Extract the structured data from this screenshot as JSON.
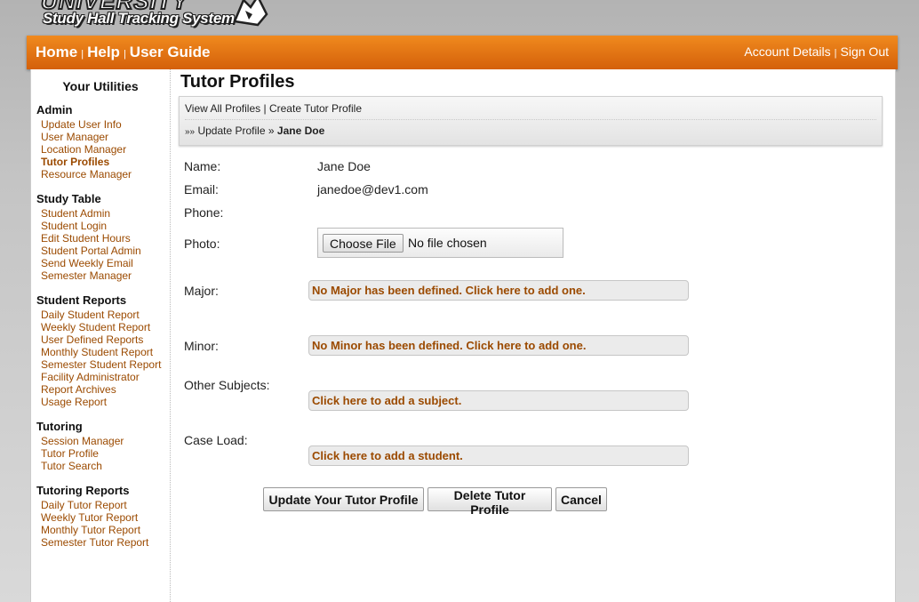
{
  "logo": {
    "wordmark": "UNIVERSITY",
    "subtitle": "Study Hall Tracking System"
  },
  "nav": {
    "home": "Home",
    "help": "Help",
    "user_guide": "User Guide",
    "sep": "|",
    "account": "Account Details",
    "signout": "Sign Out"
  },
  "sidebar": {
    "title": "Your Utilities",
    "admin": {
      "heading": "Admin",
      "items": [
        "Update User Info",
        "User Manager",
        "Location Manager",
        "Tutor Profiles",
        "Resource Manager"
      ]
    },
    "study_table": {
      "heading": "Study Table",
      "items": [
        "Student Admin",
        "Student Login",
        "Edit Student Hours",
        "Student Portal Admin",
        "Send Weekly Email",
        "Semester Manager"
      ]
    },
    "student_reports": {
      "heading": "Student Reports",
      "items": [
        "Daily Student Report",
        "Weekly Student Report",
        "User Defined Reports",
        "Monthly Student Report",
        "Semester Student Report",
        "Facility Administrator",
        "Report Archives",
        "Usage Report"
      ]
    },
    "tutoring": {
      "heading": "Tutoring",
      "items": [
        "Session Manager",
        "Tutor Profile",
        "Tutor Search"
      ]
    },
    "tutoring_reports": {
      "heading": "Tutoring Reports",
      "items": [
        "Daily Tutor Report",
        "Weekly Tutor Report",
        "Monthly Tutor Report",
        "Semester Tutor Report"
      ]
    }
  },
  "page": {
    "title": "Tutor Profiles",
    "crumbs": {
      "view_all": "View All Profiles",
      "sep": "|",
      "create": "Create Tutor Profile",
      "marker": "»»",
      "update": "Update Profile",
      "arrow": "»",
      "current": "Jane Doe"
    }
  },
  "form": {
    "name_label": "Name:",
    "name_value": "Jane Doe",
    "email_label": "Email:",
    "email_value": "janedoe@dev1.com",
    "phone_label": "Phone:",
    "photo_label": "Photo:",
    "file_button": "Choose File",
    "file_status": "No file chosen",
    "major_label": "Major:",
    "major_prompt": "No Major has been defined. Click here to add one.",
    "minor_label": "Minor:",
    "minor_prompt": "No Minor has been defined. Click here to add one.",
    "other_label": "Other Subjects:",
    "other_prompt": "Click here to add a subject.",
    "caseload_label": "Case Load:",
    "caseload_prompt": "Click here to add a student."
  },
  "buttons": {
    "update": "Update Your Tutor Profile",
    "delete": "Delete Tutor Profile",
    "cancel": "Cancel"
  },
  "colors": {
    "nav_orange": "#e8760f",
    "link_brown": "#9b4a00"
  }
}
